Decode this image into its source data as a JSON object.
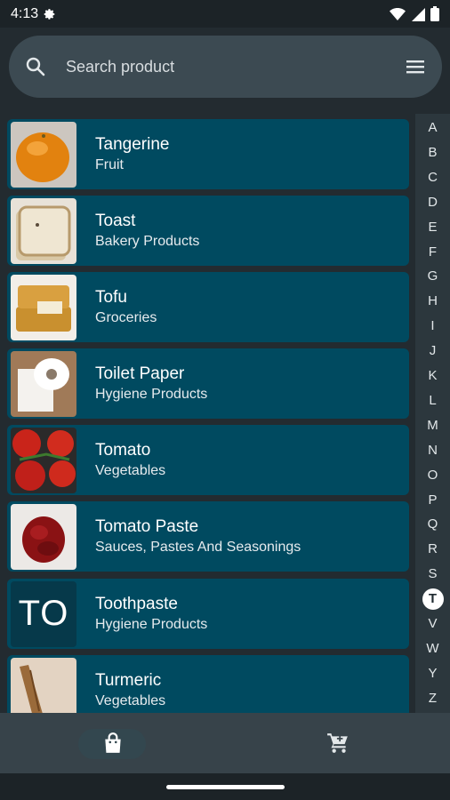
{
  "status_bar": {
    "time": "4:13",
    "icons": [
      "gear-icon",
      "wifi-icon",
      "signal-icon",
      "battery-icon"
    ]
  },
  "search": {
    "placeholder": "Search product",
    "icon": "search-icon",
    "menu_icon": "menu-icon"
  },
  "products": [
    {
      "name": "Tangerine",
      "category": "Fruit",
      "thumb": "tangerine"
    },
    {
      "name": "Toast",
      "category": "Bakery Products",
      "thumb": "toast"
    },
    {
      "name": "Tofu",
      "category": "Groceries",
      "thumb": "tofu"
    },
    {
      "name": "Toilet Paper",
      "category": "Hygiene Products",
      "thumb": "toilet-paper"
    },
    {
      "name": "Tomato",
      "category": "Vegetables",
      "thumb": "tomato"
    },
    {
      "name": "Tomato Paste",
      "category": "Sauces, Pastes And Seasonings",
      "thumb": "tomato-paste"
    },
    {
      "name": "Toothpaste",
      "category": "Hygiene Products",
      "thumb_text": "TO"
    },
    {
      "name": "Turmeric",
      "category": "Vegetables",
      "thumb": "turmeric"
    }
  ],
  "alphabet_index": {
    "letters": [
      "A",
      "B",
      "C",
      "D",
      "E",
      "F",
      "G",
      "H",
      "I",
      "J",
      "K",
      "L",
      "M",
      "N",
      "O",
      "P",
      "Q",
      "R",
      "S",
      "T",
      "V",
      "W",
      "Y",
      "Z"
    ],
    "active": "T"
  },
  "bottom_nav": {
    "tabs": [
      {
        "icon": "shopping-bag-icon",
        "selected": true
      },
      {
        "icon": "cart-icon",
        "selected": false
      }
    ]
  },
  "colors": {
    "background": "#232b30",
    "card": "#004a60",
    "search_bar": "#3c4a52",
    "bottom_nav": "#37434a"
  }
}
